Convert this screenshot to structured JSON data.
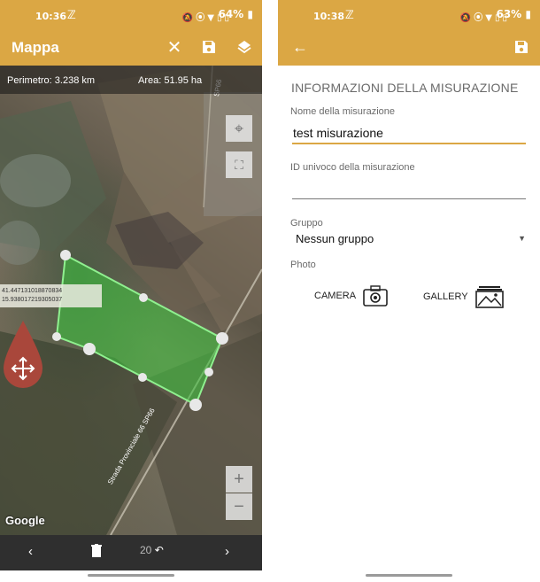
{
  "left": {
    "status": {
      "time": "10:36",
      "battery": "64%"
    },
    "appbar": {
      "title": "Mappa"
    },
    "map": {
      "perimeter": "Perimetro: 3.238 km",
      "area": "Area: 51.95 ha",
      "coord_lat": "41.447131018870834",
      "coord_lon": "15.938017219305037",
      "road_label": "Strada Provinciale 66 SP66",
      "road_label_top": "SP66",
      "google": "Google",
      "zoom_in": "+",
      "zoom_out": "−"
    },
    "bottom": {
      "counter": "20"
    }
  },
  "right": {
    "status": {
      "time": "10:38",
      "battery": "63%"
    },
    "section_title": "INFORMAZIONI DELLA MISURAZIONE",
    "name_label": "Nome della misurazione",
    "name_value": "test misurazione",
    "id_label": "ID univoco della misurazione",
    "id_value": "",
    "group_label": "Gruppo",
    "group_value": "Nessun gruppo",
    "photo_label": "Photo",
    "camera_label": "CAMERA",
    "gallery_label": "GALLERY"
  },
  "colors": {
    "accent": "#dba744",
    "polygon_fill": "#3fbf3f",
    "drag_handle": "#a9473b"
  }
}
